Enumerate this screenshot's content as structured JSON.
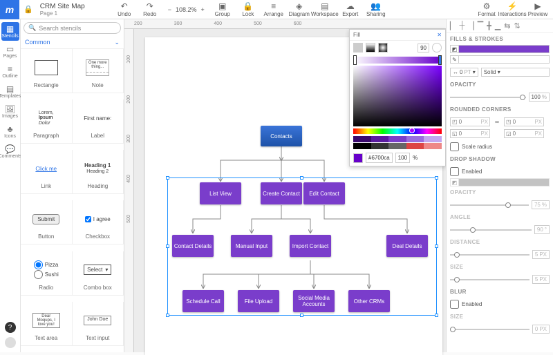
{
  "header": {
    "title": "CRM Site Map",
    "page": "Page 1",
    "zoom": "108.2%",
    "undo": "Undo",
    "redo": "Redo",
    "group": "Group",
    "lock": "Lock",
    "arrange": "Arrange",
    "diagram": "Diagram",
    "workspace": "Workspace",
    "export": "Export",
    "sharing": "Sharing",
    "format": "Format",
    "interactions": "Interactions",
    "preview": "Preview"
  },
  "leftrail": {
    "stencils": "Stencils",
    "pages": "Pages",
    "outline": "Outline",
    "templates": "Templates",
    "images": "Images",
    "icons": "Icons",
    "comments": "Comments"
  },
  "stencil": {
    "search_placeholder": "Search stencils",
    "category": "Common",
    "items": {
      "rectangle": "Rectangle",
      "note": "Note",
      "note_text": "One more thing...",
      "paragraph": "Paragraph",
      "para_l1": "Lorem,",
      "para_l2": "Ipsum",
      "para_l3": "Dolor",
      "label": "Label",
      "label_text": "First name:",
      "link": "Link",
      "link_text": "Click me",
      "heading": "Heading",
      "heading1": "Heading 1",
      "heading2": "Heading 2",
      "button": "Button",
      "button_text": "Submit",
      "checkbox": "Checkbox",
      "checkbox_text": "I agree",
      "radio": "Radio",
      "radio_a": "Pizza",
      "radio_b": "Sushi",
      "combobox": "Combo box",
      "combobox_text": "Select",
      "textarea": "Text area",
      "textarea_text": "Dear Moqups, I love you!",
      "textinput": "Text input",
      "textinput_text": "John Doe"
    }
  },
  "flow": {
    "contacts": "Contacts",
    "list_view": "List View",
    "create_contact": "Create Contact",
    "edit_contact": "Edit Contact",
    "contact_details": "Contact Details",
    "manual_input": "Manual Input",
    "import_contact": "Import Contact",
    "deal_details": "Deal Details",
    "schedule_call": "Schedule Call",
    "file_upload": "File Upload",
    "social_media": "Social Media Accounts",
    "other_crms": "Other CRMs"
  },
  "fill_popover": {
    "title": "Fill",
    "opacity_value": "90",
    "hex": "#6700ca",
    "alpha": "100",
    "alpha_unit": "%"
  },
  "right": {
    "fills_strokes": "FILLS & STROKES",
    "stroke_width": "0",
    "stroke_unit": "PT",
    "stroke_style": "Solid",
    "opacity": "OPACITY",
    "opacity_val": "100",
    "pct": "%",
    "rounded_corners": "ROUNDED CORNERS",
    "corner_val": "0",
    "px": "PX",
    "scale_radius": "Scale radius",
    "drop_shadow": "DROP SHADOW",
    "enabled": "Enabled",
    "ds_opacity": "OPACITY",
    "ds_opacity_val": "75",
    "angle": "ANGLE",
    "angle_val": "90",
    "distance": "DISTANCE",
    "distance_val": "5",
    "size": "SIZE",
    "size_val": "5",
    "blur": "BLUR",
    "blur_size_val": "0"
  },
  "rulers": {
    "h": [
      "200",
      "300",
      "400",
      "500",
      "600"
    ],
    "v": [
      "100",
      "200",
      "300",
      "400",
      "500"
    ]
  }
}
